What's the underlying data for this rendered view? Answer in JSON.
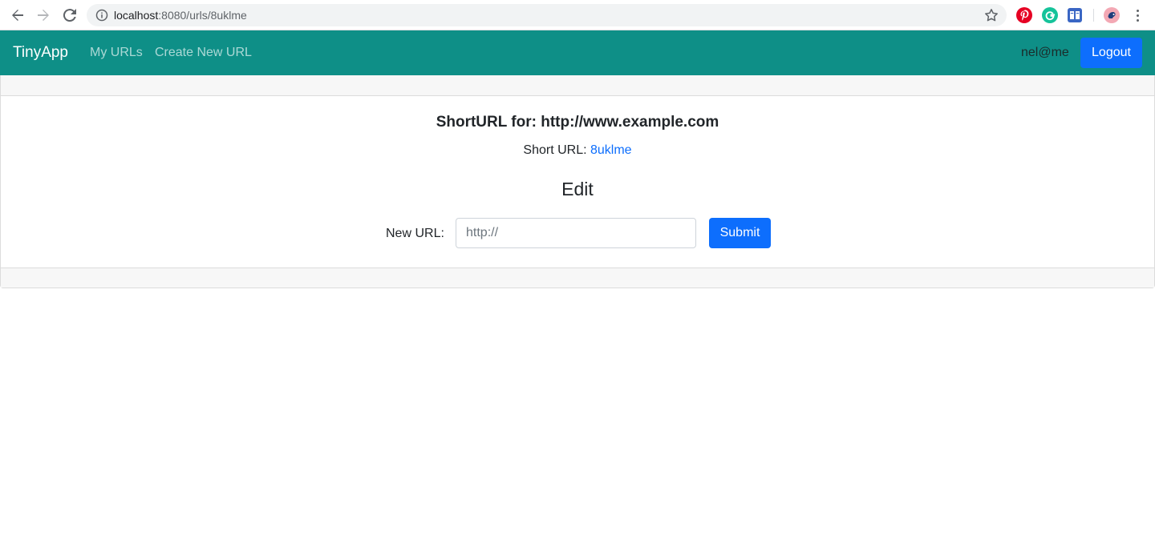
{
  "browser": {
    "url_host": "localhost",
    "url_rest": ":8080/urls/8uklme",
    "icons": [
      "back-icon",
      "forward-icon",
      "reload-icon",
      "info-icon",
      "star-icon",
      "pinterest-extension-icon",
      "grammarly-extension-icon",
      "reader-extension-icon",
      "profile-avatar-icon",
      "menu-icon"
    ]
  },
  "navbar": {
    "brand": "TinyApp",
    "links": [
      "My URLs",
      "Create New URL"
    ],
    "user": "nel@me",
    "logout_label": "Logout",
    "color": "#0e8f87"
  },
  "main": {
    "title": "ShortURL for: http://www.example.com",
    "short_url_label": "Short URL:",
    "short_url_value": "8uklme",
    "edit_heading": "Edit",
    "form": {
      "label": "New URL:",
      "placeholder": "http://",
      "value": "",
      "submit_label": "Submit"
    }
  },
  "colors": {
    "primary": "#0d6efd",
    "link": "#0d6efd"
  }
}
